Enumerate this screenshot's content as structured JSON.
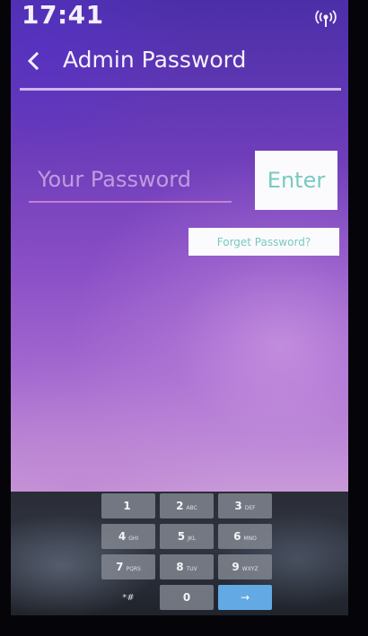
{
  "status_bar": {
    "time": "17:41",
    "signal_icon": "wireless-signal-icon"
  },
  "header": {
    "back_icon": "chevron-left-icon",
    "title": "Admin Password"
  },
  "form": {
    "password_placeholder": "Your Password",
    "password_value": "",
    "enter_label": "Enter",
    "forget_label": "Forget Password?"
  },
  "keypad": {
    "keys": [
      {
        "digit": "1",
        "letters": ""
      },
      {
        "digit": "2",
        "letters": "ABC"
      },
      {
        "digit": "3",
        "letters": "DEF"
      },
      {
        "digit": "4",
        "letters": "GHI"
      },
      {
        "digit": "5",
        "letters": "JKL"
      },
      {
        "digit": "6",
        "letters": "MNO"
      },
      {
        "digit": "7",
        "letters": "PQRS"
      },
      {
        "digit": "8",
        "letters": "TUV"
      },
      {
        "digit": "9",
        "letters": "WXYZ"
      }
    ],
    "symbols_label": "*#",
    "zero_label": "0",
    "go_label": "→"
  },
  "colors": {
    "accent": "#79c9c3",
    "go_key": "#63a9e3"
  }
}
